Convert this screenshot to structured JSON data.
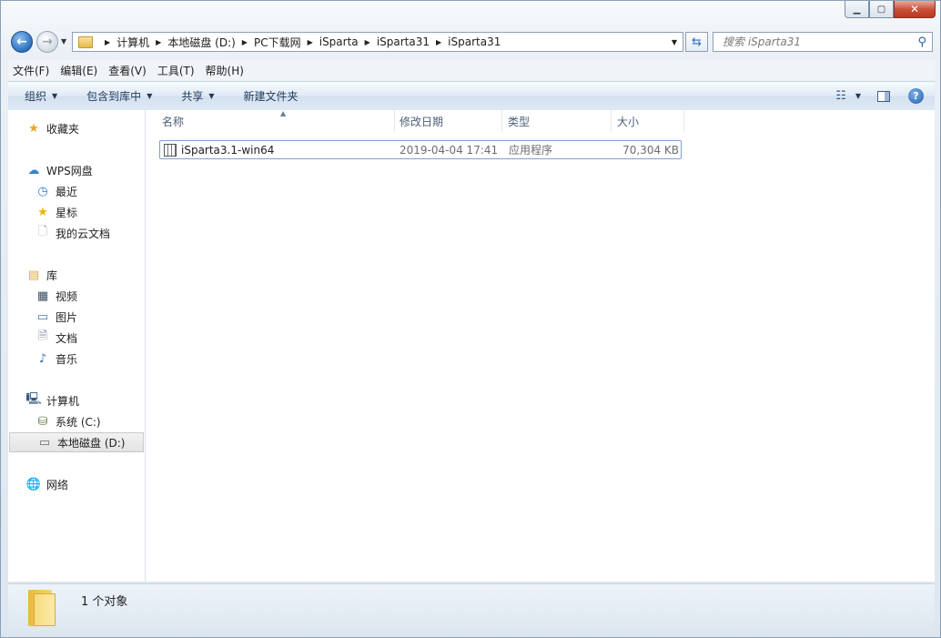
{
  "address": {
    "crumbs": [
      "计算机",
      "本地磁盘 (D:)",
      "PC下载网",
      "iSparta",
      "iSparta31",
      "iSparta31"
    ]
  },
  "search": {
    "placeholder": "搜索 iSparta31"
  },
  "menu": [
    "文件(F)",
    "编辑(E)",
    "查看(V)",
    "工具(T)",
    "帮助(H)"
  ],
  "toolbar": {
    "organize": "组织",
    "include_in_library": "包含到库中",
    "share": "共享",
    "new_folder": "新建文件夹"
  },
  "nav": {
    "favorites": "收藏夹",
    "wps": "WPS网盘",
    "recent": "最近",
    "starred": "星标",
    "my_cloud_docs": "我的云文档",
    "libraries": "库",
    "videos": "视频",
    "pictures": "图片",
    "documents": "文档",
    "music": "音乐",
    "computer": "计算机",
    "drive_c": "系统 (C:)",
    "drive_d": "本地磁盘 (D:)",
    "network": "网络"
  },
  "columns": {
    "name": "名称",
    "modified": "修改日期",
    "type": "类型",
    "size": "大小"
  },
  "files": [
    {
      "name": "iSparta3.1-win64",
      "modified": "2019-04-04 17:41",
      "type": "应用程序",
      "size": "70,304 KB"
    }
  ],
  "status": {
    "count_text": "1 个对象"
  },
  "icons": {
    "back": "back-arrow-icon",
    "forward": "forward-arrow-icon",
    "refresh": "refresh-icon",
    "search": "search-icon",
    "help": "help-icon"
  },
  "colors": {
    "accent": "#2a6fc1",
    "close_button": "#c94c36",
    "selection_border": "#7da2ce"
  }
}
